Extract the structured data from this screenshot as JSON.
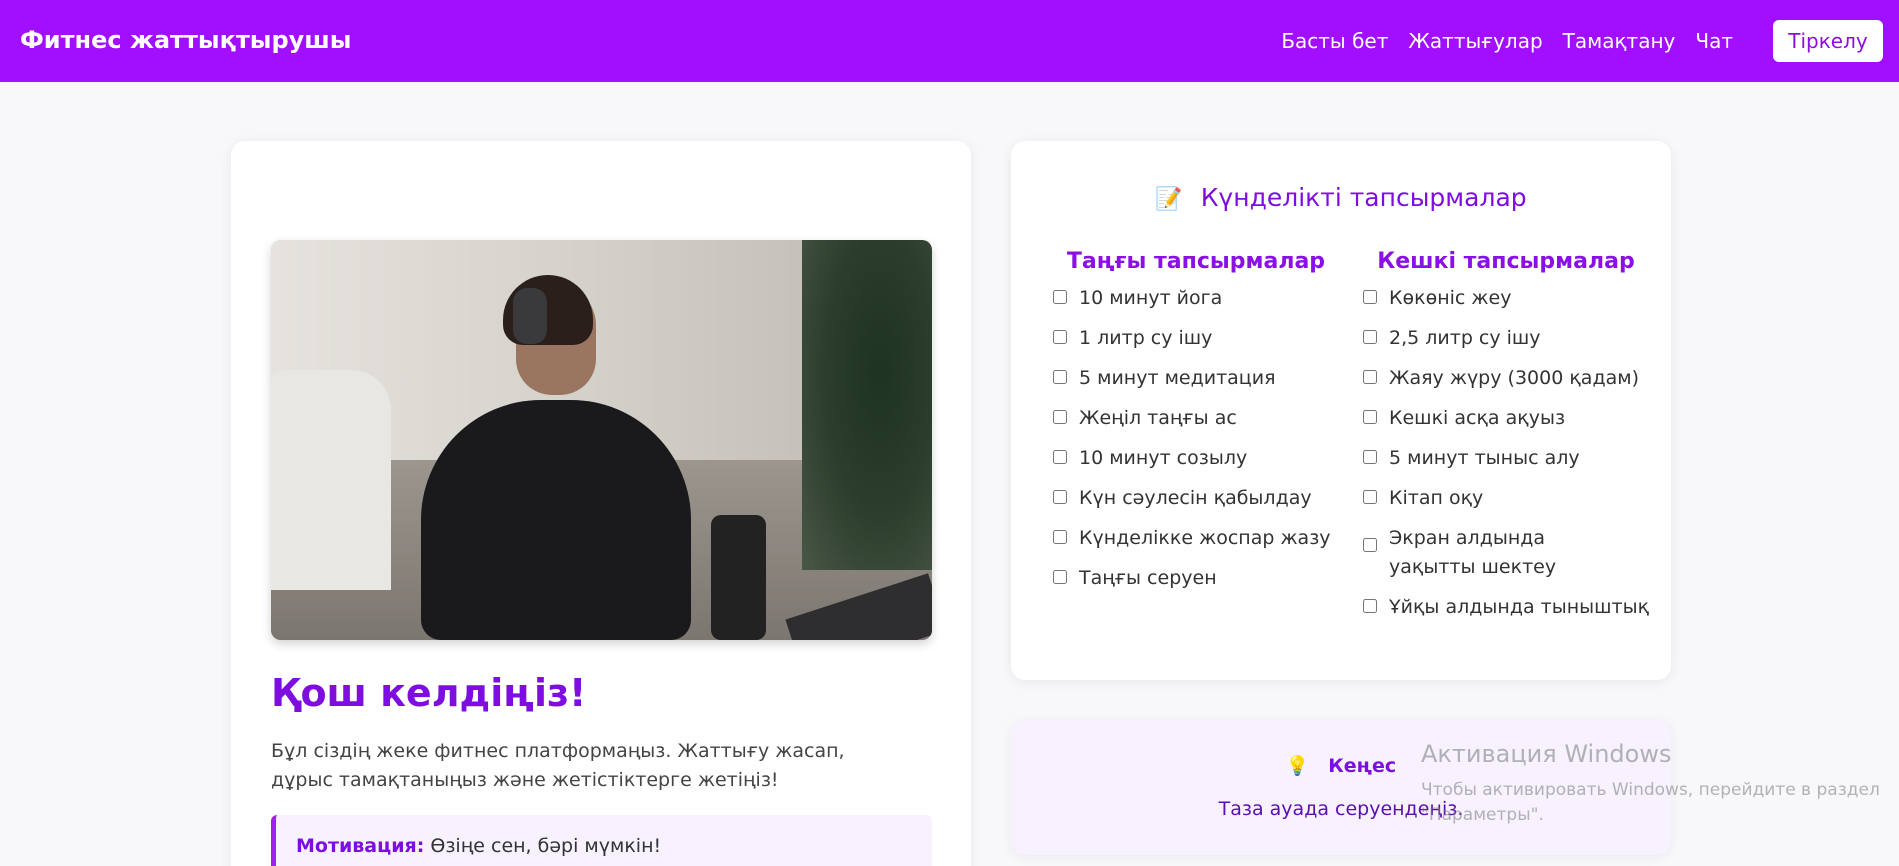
{
  "header": {
    "brand": "Фитнес жаттықтырушы",
    "nav": [
      "Басты бет",
      "Жаттығулар",
      "Тамақтану",
      "Чат"
    ],
    "signup_label": "Тіркелу",
    "colors": {
      "bar": "#a10ffe",
      "accent": "#7e0de0"
    }
  },
  "hero": {
    "welcome": "Қош келдіңіз!",
    "intro": "Бұл сіздің жеке фитнес платформаңыз. Жаттығу жасап, дұрыс тамақтаныңыз және жетістіктерге жетіңіз!",
    "motivation_label": "Мотивация:",
    "motivation_text": "Өзіңе сен, бәрі мүмкін!"
  },
  "tasks": {
    "icon": "memo-icon",
    "title": "Күнделікті тапсырмалар",
    "morning": {
      "heading": "Таңғы тапсырмалар",
      "items": [
        "10 минут йога",
        "1 литр су ішу",
        "5 минут медитация",
        "Жеңіл таңғы ас",
        "10 минут созылу",
        "Күн сәулесін қабылдау",
        "Күнделікке жоспар жазу",
        "Таңғы серуен"
      ]
    },
    "evening": {
      "heading": "Кешкі тапсырмалар",
      "items": [
        "Көкөніс жеу",
        "2,5 литр су ішу",
        "Жаяу жүру (3000 қадам)",
        "Кешкі асқа ақуыз",
        "5 минут тыныс алу",
        "Кітап оқу",
        "Экран алдында уақытты шектеу",
        "Ұйқы алдында тыныштық"
      ]
    }
  },
  "tip": {
    "icon": "lightbulb-icon",
    "heading": "Кеңес",
    "text": "Таза ауада серуендеңіз."
  },
  "watermark": {
    "title": "Активация Windows",
    "text": "Чтобы активировать Windows, перейдите в раздел \"Параметры\"."
  }
}
